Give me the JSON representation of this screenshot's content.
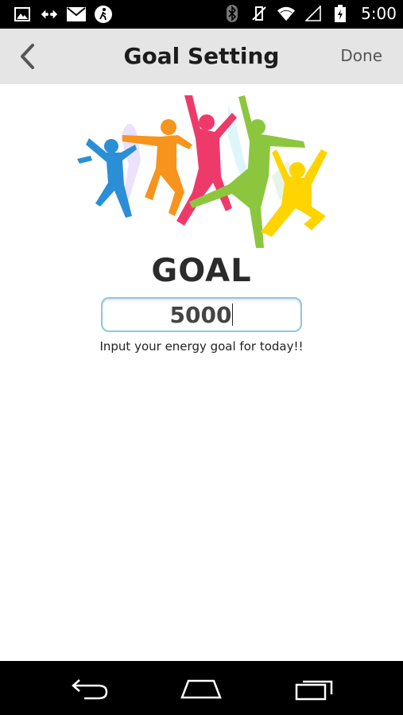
{
  "status_bar": {
    "time": "5:00",
    "left_icons": [
      "gallery-icon",
      "usb-debug-icon",
      "mail-icon",
      "pedometer-icon"
    ],
    "right_icons": [
      "bluetooth-icon",
      "vibrate-off-icon",
      "wifi-icon",
      "signal-icon",
      "battery-charging-icon"
    ]
  },
  "action_bar": {
    "back_icon": "chevron-left-icon",
    "title": "Goal Setting",
    "done_label": "Done"
  },
  "hero": {
    "description_icon": "jumping-people-illustration",
    "colors": [
      "#2a8fd6",
      "#f7941d",
      "#ee3a6b",
      "#8cc63f",
      "#ffd400",
      "#b388ff"
    ]
  },
  "goal": {
    "heading": "GOAL",
    "value": "5000",
    "hint": "Input your energy goal for today!!"
  },
  "nav_bar": {
    "icons": [
      "back-nav-icon",
      "home-nav-icon",
      "recents-nav-icon"
    ]
  }
}
